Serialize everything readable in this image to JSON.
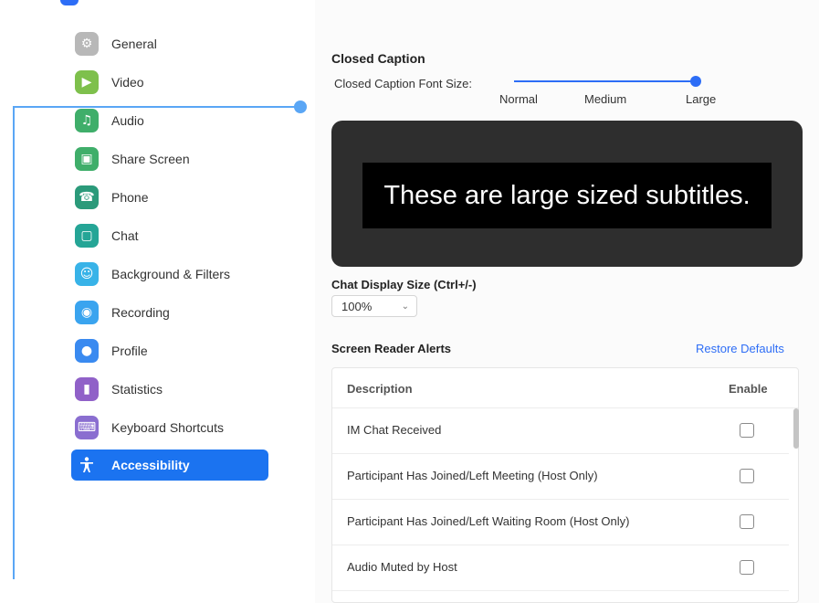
{
  "sidebar": {
    "items": [
      {
        "label": "General",
        "icon": "gear-icon",
        "color": "#b8b8b8"
      },
      {
        "label": "Video",
        "icon": "video-camera-icon",
        "color": "#7ec04c"
      },
      {
        "label": "Audio",
        "icon": "headphones-icon",
        "color": "#3fae6a"
      },
      {
        "label": "Share Screen",
        "icon": "share-screen-icon",
        "color": "#3fae6a"
      },
      {
        "label": "Phone",
        "icon": "phone-icon",
        "color": "#2b9a7a"
      },
      {
        "label": "Chat",
        "icon": "chat-bubble-icon",
        "color": "#25a596"
      },
      {
        "label": "Background & Filters",
        "icon": "background-person-icon",
        "color": "#38b3e8"
      },
      {
        "label": "Recording",
        "icon": "recording-icon",
        "color": "#3aa4ef"
      },
      {
        "label": "Profile",
        "icon": "profile-icon",
        "color": "#3a8af0"
      },
      {
        "label": "Statistics",
        "icon": "statistics-icon",
        "color": "#9061c8"
      },
      {
        "label": "Keyboard Shortcuts",
        "icon": "keyboard-icon",
        "color": "#8a6ed0"
      },
      {
        "label": "Accessibility",
        "icon": "accessibility-icon",
        "color": "#ffffff",
        "active": true
      }
    ]
  },
  "closed_caption": {
    "title": "Closed Caption",
    "font_size_label": "Closed Caption Font Size:",
    "slider_options": [
      "Normal",
      "Medium",
      "Large"
    ],
    "selected": "Large",
    "preview_text": "These are large sized subtitles."
  },
  "chat_display": {
    "title": "Chat Display Size (Ctrl+/-)",
    "value": "100%"
  },
  "screen_reader": {
    "title": "Screen Reader Alerts",
    "restore_label": "Restore Defaults",
    "col_description": "Description",
    "col_enable": "Enable",
    "rows": [
      {
        "description": "IM Chat Received",
        "enabled": false
      },
      {
        "description": "Participant Has Joined/Left Meeting (Host Only)",
        "enabled": false
      },
      {
        "description": "Participant Has Joined/Left Waiting Room (Host Only)",
        "enabled": false
      },
      {
        "description": "Audio Muted by Host",
        "enabled": false
      }
    ]
  },
  "colors": {
    "accent": "#1b73f0",
    "connector": "#5aa6f5"
  }
}
